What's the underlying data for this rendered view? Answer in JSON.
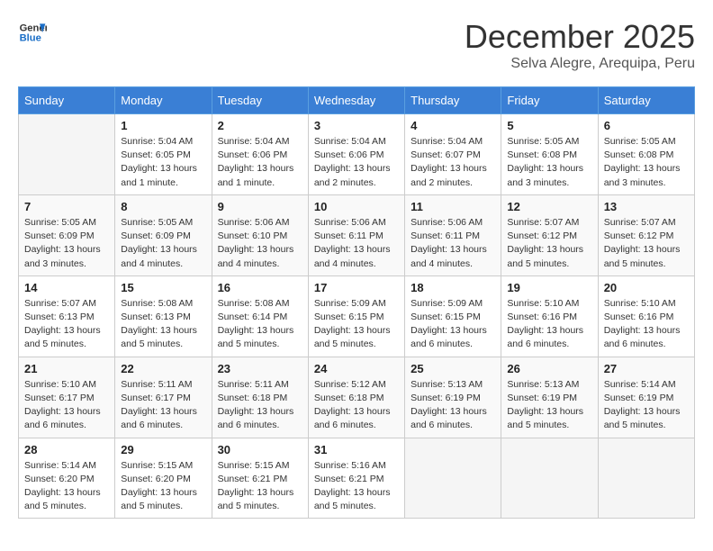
{
  "logo": {
    "line1": "General",
    "line2": "Blue"
  },
  "title": "December 2025",
  "location": "Selva Alegre, Arequipa, Peru",
  "days_of_week": [
    "Sunday",
    "Monday",
    "Tuesday",
    "Wednesday",
    "Thursday",
    "Friday",
    "Saturday"
  ],
  "weeks": [
    [
      {
        "day": "",
        "info": ""
      },
      {
        "day": "1",
        "info": "Sunrise: 5:04 AM\nSunset: 6:05 PM\nDaylight: 13 hours\nand 1 minute."
      },
      {
        "day": "2",
        "info": "Sunrise: 5:04 AM\nSunset: 6:06 PM\nDaylight: 13 hours\nand 1 minute."
      },
      {
        "day": "3",
        "info": "Sunrise: 5:04 AM\nSunset: 6:06 PM\nDaylight: 13 hours\nand 2 minutes."
      },
      {
        "day": "4",
        "info": "Sunrise: 5:04 AM\nSunset: 6:07 PM\nDaylight: 13 hours\nand 2 minutes."
      },
      {
        "day": "5",
        "info": "Sunrise: 5:05 AM\nSunset: 6:08 PM\nDaylight: 13 hours\nand 3 minutes."
      },
      {
        "day": "6",
        "info": "Sunrise: 5:05 AM\nSunset: 6:08 PM\nDaylight: 13 hours\nand 3 minutes."
      }
    ],
    [
      {
        "day": "7",
        "info": "Sunrise: 5:05 AM\nSunset: 6:09 PM\nDaylight: 13 hours\nand 3 minutes."
      },
      {
        "day": "8",
        "info": "Sunrise: 5:05 AM\nSunset: 6:09 PM\nDaylight: 13 hours\nand 4 minutes."
      },
      {
        "day": "9",
        "info": "Sunrise: 5:06 AM\nSunset: 6:10 PM\nDaylight: 13 hours\nand 4 minutes."
      },
      {
        "day": "10",
        "info": "Sunrise: 5:06 AM\nSunset: 6:11 PM\nDaylight: 13 hours\nand 4 minutes."
      },
      {
        "day": "11",
        "info": "Sunrise: 5:06 AM\nSunset: 6:11 PM\nDaylight: 13 hours\nand 4 minutes."
      },
      {
        "day": "12",
        "info": "Sunrise: 5:07 AM\nSunset: 6:12 PM\nDaylight: 13 hours\nand 5 minutes."
      },
      {
        "day": "13",
        "info": "Sunrise: 5:07 AM\nSunset: 6:12 PM\nDaylight: 13 hours\nand 5 minutes."
      }
    ],
    [
      {
        "day": "14",
        "info": "Sunrise: 5:07 AM\nSunset: 6:13 PM\nDaylight: 13 hours\nand 5 minutes."
      },
      {
        "day": "15",
        "info": "Sunrise: 5:08 AM\nSunset: 6:13 PM\nDaylight: 13 hours\nand 5 minutes."
      },
      {
        "day": "16",
        "info": "Sunrise: 5:08 AM\nSunset: 6:14 PM\nDaylight: 13 hours\nand 5 minutes."
      },
      {
        "day": "17",
        "info": "Sunrise: 5:09 AM\nSunset: 6:15 PM\nDaylight: 13 hours\nand 5 minutes."
      },
      {
        "day": "18",
        "info": "Sunrise: 5:09 AM\nSunset: 6:15 PM\nDaylight: 13 hours\nand 6 minutes."
      },
      {
        "day": "19",
        "info": "Sunrise: 5:10 AM\nSunset: 6:16 PM\nDaylight: 13 hours\nand 6 minutes."
      },
      {
        "day": "20",
        "info": "Sunrise: 5:10 AM\nSunset: 6:16 PM\nDaylight: 13 hours\nand 6 minutes."
      }
    ],
    [
      {
        "day": "21",
        "info": "Sunrise: 5:10 AM\nSunset: 6:17 PM\nDaylight: 13 hours\nand 6 minutes."
      },
      {
        "day": "22",
        "info": "Sunrise: 5:11 AM\nSunset: 6:17 PM\nDaylight: 13 hours\nand 6 minutes."
      },
      {
        "day": "23",
        "info": "Sunrise: 5:11 AM\nSunset: 6:18 PM\nDaylight: 13 hours\nand 6 minutes."
      },
      {
        "day": "24",
        "info": "Sunrise: 5:12 AM\nSunset: 6:18 PM\nDaylight: 13 hours\nand 6 minutes."
      },
      {
        "day": "25",
        "info": "Sunrise: 5:13 AM\nSunset: 6:19 PM\nDaylight: 13 hours\nand 6 minutes."
      },
      {
        "day": "26",
        "info": "Sunrise: 5:13 AM\nSunset: 6:19 PM\nDaylight: 13 hours\nand 5 minutes."
      },
      {
        "day": "27",
        "info": "Sunrise: 5:14 AM\nSunset: 6:19 PM\nDaylight: 13 hours\nand 5 minutes."
      }
    ],
    [
      {
        "day": "28",
        "info": "Sunrise: 5:14 AM\nSunset: 6:20 PM\nDaylight: 13 hours\nand 5 minutes."
      },
      {
        "day": "29",
        "info": "Sunrise: 5:15 AM\nSunset: 6:20 PM\nDaylight: 13 hours\nand 5 minutes."
      },
      {
        "day": "30",
        "info": "Sunrise: 5:15 AM\nSunset: 6:21 PM\nDaylight: 13 hours\nand 5 minutes."
      },
      {
        "day": "31",
        "info": "Sunrise: 5:16 AM\nSunset: 6:21 PM\nDaylight: 13 hours\nand 5 minutes."
      },
      {
        "day": "",
        "info": ""
      },
      {
        "day": "",
        "info": ""
      },
      {
        "day": "",
        "info": ""
      }
    ]
  ]
}
